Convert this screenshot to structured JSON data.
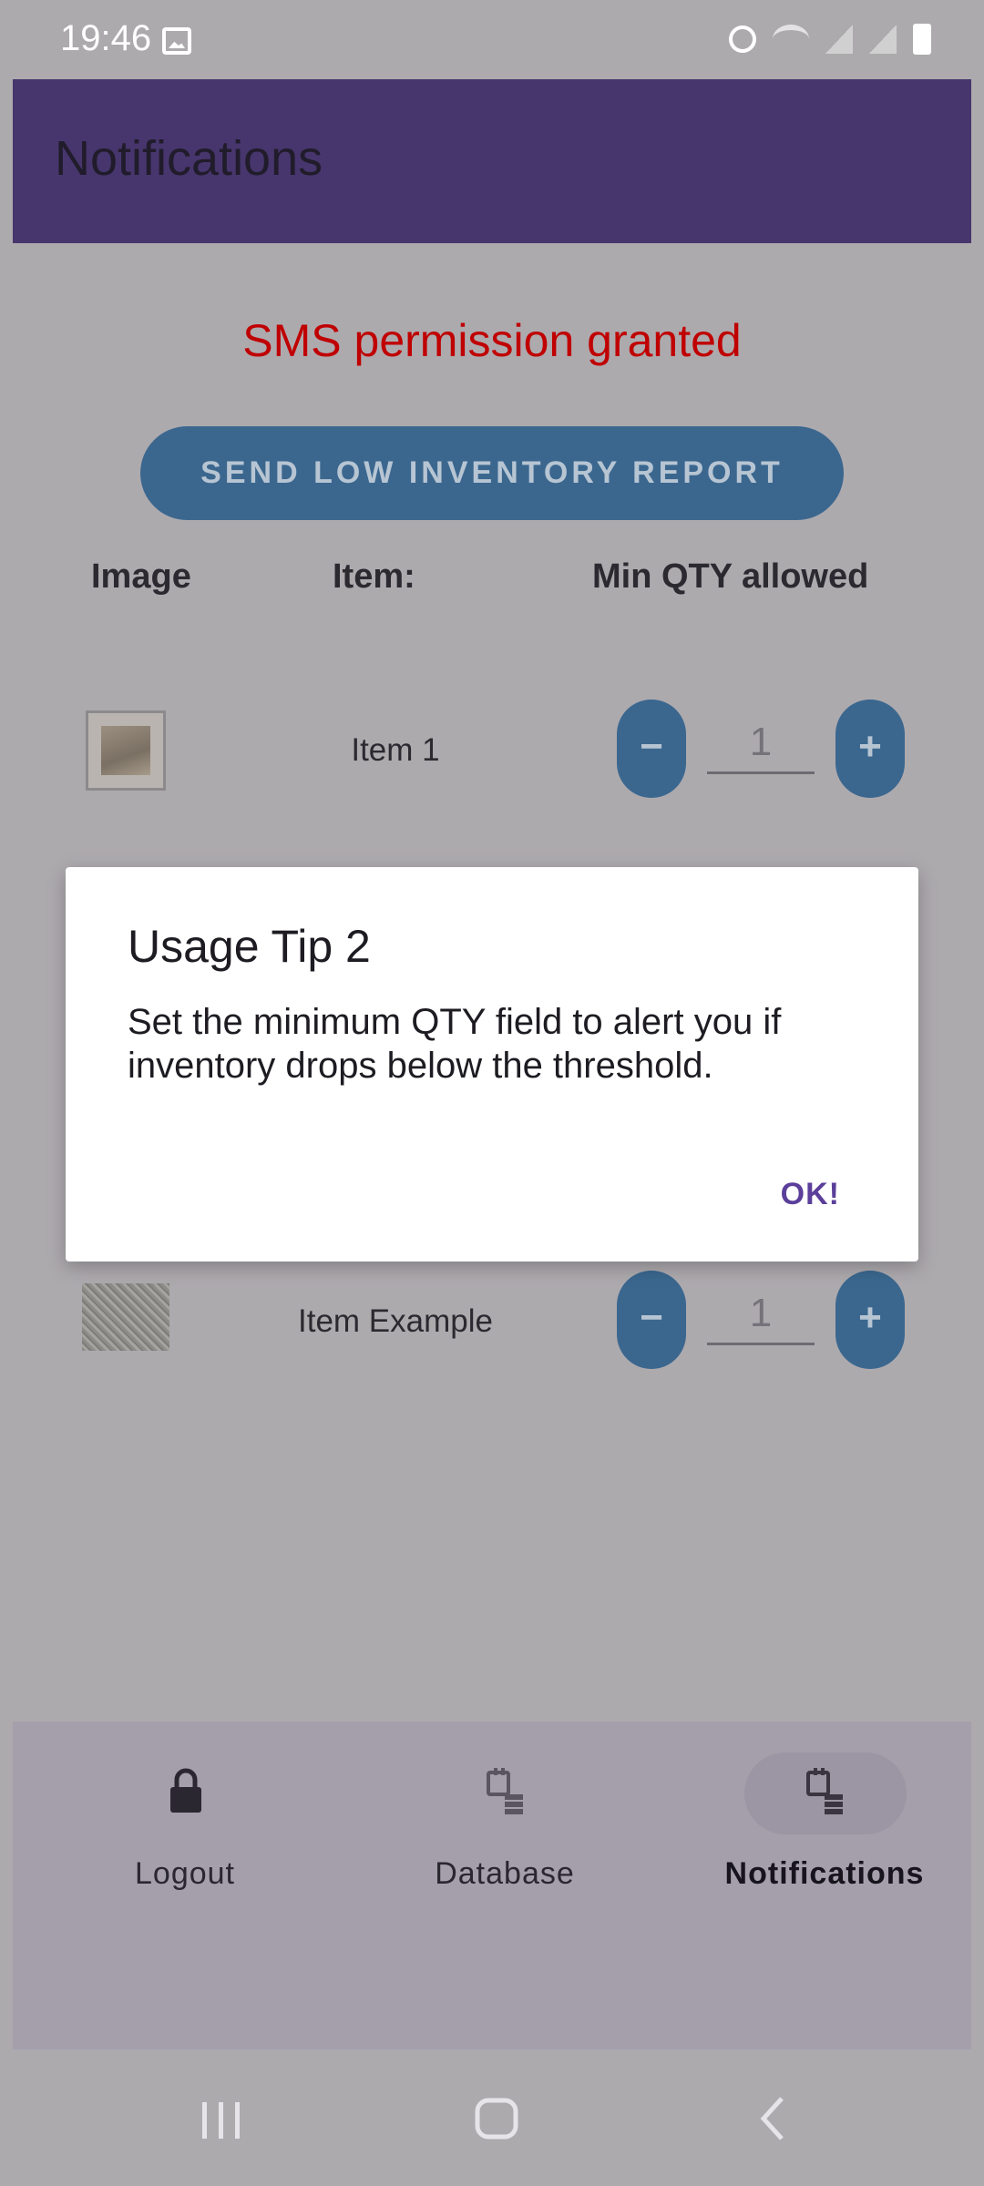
{
  "status_bar": {
    "time": "19:46"
  },
  "app_bar": {
    "title": "Notifications"
  },
  "content": {
    "sms_status": "SMS permission granted",
    "report_button": "SEND LOW INVENTORY REPORT",
    "columns": {
      "image": "Image",
      "item": "Item:",
      "min_qty": "Min QTY allowed"
    },
    "rows": [
      {
        "name": "Item 1",
        "min_qty": "1",
        "minus": "−",
        "plus": "+"
      },
      {
        "name": "Item Example",
        "min_qty": "1",
        "minus": "−",
        "plus": "+"
      }
    ]
  },
  "dialog": {
    "title": "Usage Tip 2",
    "message": "Set the minimum QTY field to alert you if inventory drops below the threshold.",
    "ok_label": "OK!"
  },
  "bottom_nav": {
    "items": [
      {
        "label": "Logout",
        "icon": "lock-icon",
        "active": false
      },
      {
        "label": "Database",
        "icon": "database-icon",
        "active": false
      },
      {
        "label": "Notifications",
        "icon": "database-icon",
        "active": true
      }
    ]
  },
  "colors": {
    "app_bar": "#47366d",
    "accent_button": "#3b678f",
    "sms_status": "#c00000",
    "dialog_action": "#5b3f9a"
  }
}
